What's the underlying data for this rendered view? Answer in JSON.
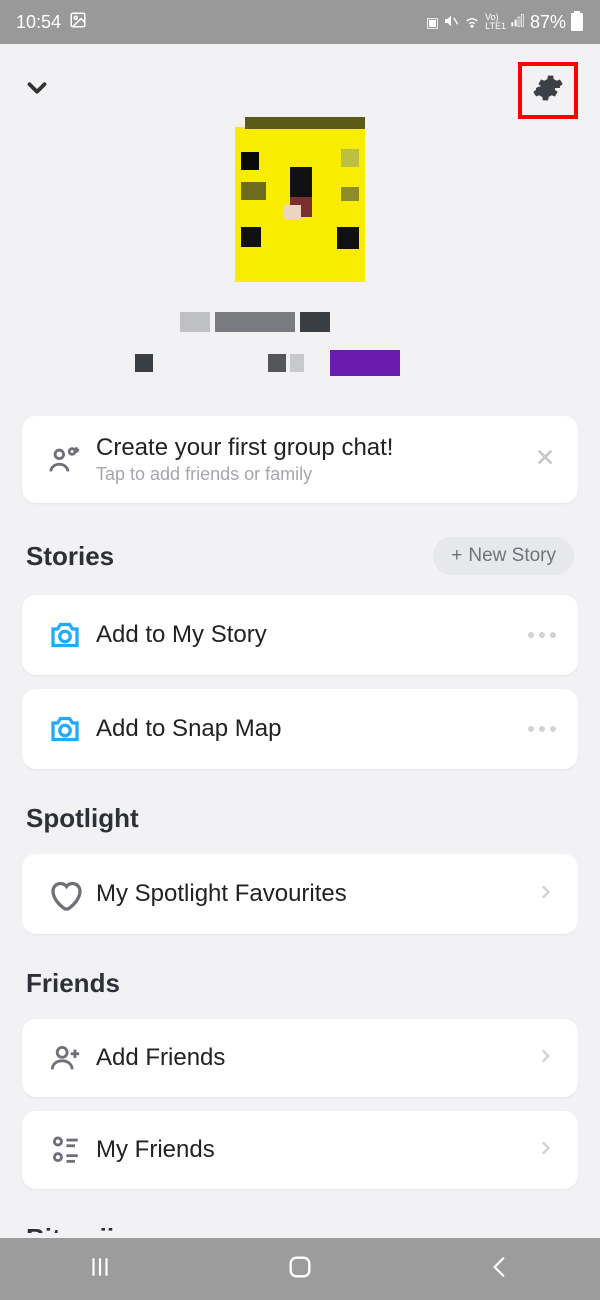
{
  "status": {
    "time": "10:54",
    "battery": "87%"
  },
  "groupchat": {
    "title": "Create your first group chat!",
    "subtitle": "Tap to add friends or family"
  },
  "sections": {
    "stories": {
      "title": "Stories",
      "new_button": "New Story",
      "items": [
        {
          "label": "Add to My Story"
        },
        {
          "label": "Add to Snap Map"
        }
      ]
    },
    "spotlight": {
      "title": "Spotlight",
      "items": [
        {
          "label": "My Spotlight Favourites"
        }
      ]
    },
    "friends": {
      "title": "Friends",
      "items": [
        {
          "label": "Add Friends"
        },
        {
          "label": "My Friends"
        }
      ]
    },
    "bitmoji": {
      "title": "Bitmoji"
    }
  }
}
